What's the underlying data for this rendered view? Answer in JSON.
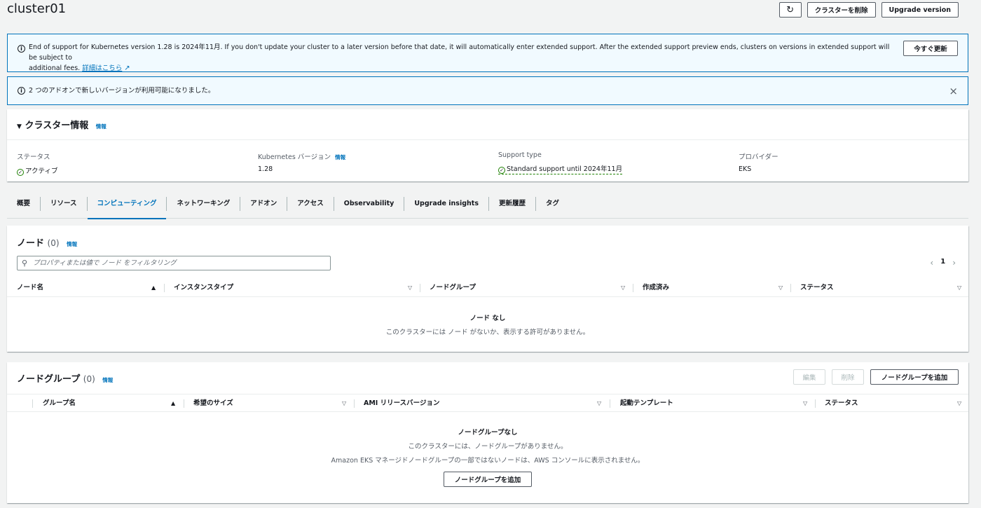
{
  "page": {
    "title": "cluster01"
  },
  "header_actions": {
    "refresh_icon": "refresh-icon",
    "delete_label": "クラスターを削除",
    "upgrade_label": "Upgrade version"
  },
  "alert_eos": {
    "text_line1": "End of support for Kubernetes version 1.28 is 2024年11月. If you don't update your cluster to a later version before that date, it will automatically enter extended support. After the extended support preview ends, clusters on versions in extended support will be subject to",
    "text_line2": "additional fees.",
    "link": "詳細はこちら",
    "button": "今すぐ更新"
  },
  "alert_addon": {
    "text": "2 つのアドオンで新しいバージョンが利用可能になりました。",
    "close": "×"
  },
  "cluster_info": {
    "title": "クラスター情報",
    "info": "情報",
    "status_label": "ステータス",
    "status_value": "アクティブ",
    "k8s_label": "Kubernetes バージョン",
    "k8s_info": "情報",
    "k8s_value": "1.28",
    "support_label": "Support type",
    "support_value": "Standard support until 2024年11月",
    "provider_label": "プロバイダー",
    "provider_value": "EKS"
  },
  "tabs": [
    "概要",
    "リソース",
    "コンピューティング",
    "ネットワーキング",
    "アドオン",
    "アクセス",
    "Observability",
    "Upgrade insights",
    "更新履歴",
    "タグ"
  ],
  "nodes": {
    "title": "ノード",
    "count": "(0)",
    "info": "情報",
    "filter_placeholder": "プロパティまたは値で ノード をフィルタリング",
    "page": "1",
    "columns": [
      "ノード名",
      "インスタンスタイプ",
      "ノードグループ",
      "作成済み",
      "ステータス"
    ],
    "empty_title": "ノード なし",
    "empty_desc": "このクラスターには ノード がないか、表示する許可がありません。"
  },
  "nodegroups": {
    "title": "ノードグループ",
    "count": "(0)",
    "info": "情報",
    "edit_label": "編集",
    "delete_label": "削除",
    "add_label": "ノードグループを追加",
    "columns": [
      "グループ名",
      "希望のサイズ",
      "AMI リリースバージョン",
      "起動テンプレート",
      "ステータス"
    ],
    "empty_title": "ノードグループなし",
    "empty_desc1": "このクラスターには、ノードグループがありません。",
    "empty_desc2": "Amazon EKS マネージドノードグループの一部ではないノードは、AWS コンソールに表示されません。",
    "empty_button": "ノードグループを追加"
  },
  "colors": {
    "accent": "#0073bb",
    "success": "#1d8102",
    "alert_bg": "#f1faff"
  }
}
